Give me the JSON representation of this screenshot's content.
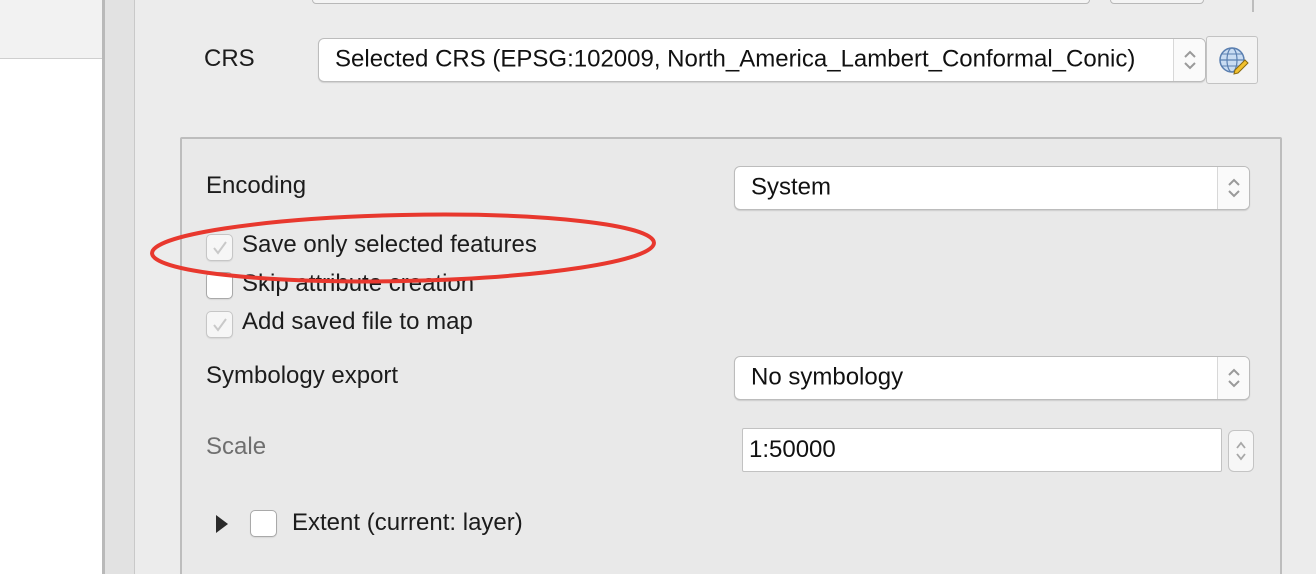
{
  "crs": {
    "label": "CRS",
    "selected_value": "Selected CRS (EPSG:102009, North_America_Lambert_Conformal_Conic)",
    "select_button_icon": "globe-icon"
  },
  "options": {
    "encoding": {
      "label": "Encoding",
      "selected_value": "System"
    },
    "save_only_selected": {
      "label": "Save only selected features",
      "checked": true,
      "enabled": false
    },
    "skip_attribute_creation": {
      "label": "Skip attribute creation",
      "checked": false,
      "enabled": true
    },
    "add_saved_file_to_map": {
      "label": "Add saved file to map",
      "checked": true,
      "enabled": false
    },
    "symbology_export": {
      "label": "Symbology export",
      "selected_value": "No symbology"
    },
    "scale": {
      "label": "Scale",
      "value": "1:50000",
      "enabled": false
    },
    "extent": {
      "label": "Extent (current: layer)",
      "checked": false,
      "collapsed": true
    }
  },
  "annotation": {
    "color": "#e8382e",
    "target": "save-only-selected-features"
  },
  "colors": {
    "highlight": "#e8382e",
    "background": "#ececec",
    "group_border": "#bdbdbd"
  }
}
